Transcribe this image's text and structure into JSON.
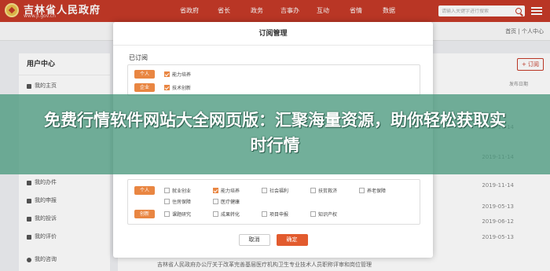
{
  "header": {
    "site_title": "吉林省人民政府",
    "site_url": "www.jl.gov.cn",
    "nav": [
      "省政府",
      "省长",
      "政务",
      "吉事办",
      "互动",
      "省情",
      "数据"
    ],
    "search_placeholder": "请输入关键字进行搜索"
  },
  "breadcrumb": "首页 | 个人中心",
  "sidebar": {
    "title": "用户中心",
    "items": [
      "我的主页",
      "我的办件",
      "我的申报",
      "我的投诉",
      "我的评价",
      "我的咨询"
    ]
  },
  "main": {
    "add_button": "+ 订阅",
    "column_header": "发布日期",
    "dates": [
      "2019-11-14",
      "2019-11-14",
      "2019-11-14",
      "2019-05-13",
      "2019-06-12",
      "2019-05-13"
    ],
    "bottom_text": "吉林省人民政府办公厅关于改革完善基层医疗机构卫生专业技术人员职称评审和岗位管理"
  },
  "dialog": {
    "title": "订阅管理",
    "subscribed_label": "已订阅",
    "subscribed": [
      {
        "tag": "个人",
        "options": [
          {
            "label": "能力培养",
            "checked": true
          }
        ]
      },
      {
        "tag": "企业",
        "options": [
          {
            "label": "技术创新",
            "checked": true
          }
        ]
      }
    ],
    "more_groups": [
      {
        "tag": "个人",
        "options": [
          {
            "label": "就业创业",
            "checked": false
          },
          {
            "label": "能力培养",
            "checked": true
          },
          {
            "label": "社会福利",
            "checked": false
          },
          {
            "label": "扶贫救济",
            "checked": false
          },
          {
            "label": "养老保障",
            "checked": false
          },
          {
            "label": "住房保障",
            "checked": false
          },
          {
            "label": "医疗健康",
            "checked": false
          }
        ]
      },
      {
        "tag": "创新",
        "options": [
          {
            "label": "课题研究",
            "checked": false
          },
          {
            "label": "成果转化",
            "checked": false
          },
          {
            "label": "项目申报",
            "checked": false
          },
          {
            "label": "知识产权",
            "checked": false
          }
        ]
      }
    ],
    "cancel_label": "取消",
    "confirm_label": "确定"
  },
  "headline": "免费行情软件网站大全网页版：汇聚海量资源，助你轻松获取实时行情",
  "colors": {
    "header_red": "#c53a28",
    "tag_orange": "#e98642",
    "banner_green": "#4a997e"
  }
}
